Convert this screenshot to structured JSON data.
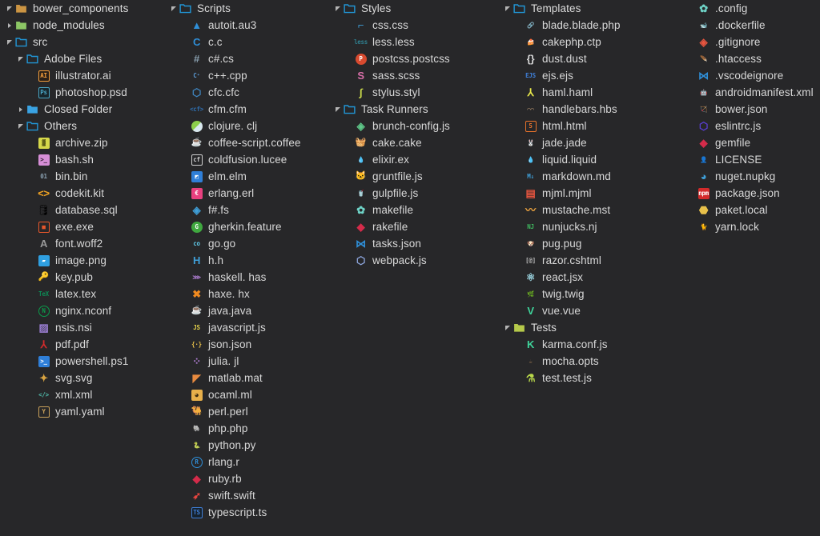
{
  "app": {
    "title": "File Icons Tree",
    "background": "#272729",
    "text_color": "#d8d8d8"
  },
  "columns": [
    {
      "name": "column-1",
      "rows": [
        {
          "indent": 0,
          "arrow": "open",
          "icon": "folder-bower",
          "label": "bower_components",
          "type": "folder"
        },
        {
          "indent": 0,
          "arrow": "closed",
          "icon": "folder-node",
          "label": "node_modules",
          "type": "folder"
        },
        {
          "indent": 0,
          "arrow": "open",
          "icon": "folder-blue",
          "label": "src",
          "type": "folder"
        },
        {
          "indent": 1,
          "arrow": "open",
          "icon": "folder-blue",
          "label": "Adobe Files",
          "type": "folder"
        },
        {
          "indent": 2,
          "arrow": "none",
          "icon": "illustrator-icon",
          "label": "illustrator.ai",
          "type": "file"
        },
        {
          "indent": 2,
          "arrow": "none",
          "icon": "photoshop-icon",
          "label": "photoshop.psd",
          "type": "file"
        },
        {
          "indent": 1,
          "arrow": "closed",
          "icon": "folder-blue-closed",
          "label": "Closed Folder",
          "type": "folder"
        },
        {
          "indent": 1,
          "arrow": "open",
          "icon": "folder-blue",
          "label": "Others",
          "type": "folder"
        },
        {
          "indent": 2,
          "arrow": "none",
          "icon": "zip-icon",
          "label": "archive.zip",
          "type": "file"
        },
        {
          "indent": 2,
          "arrow": "none",
          "icon": "shell-icon",
          "label": "bash.sh",
          "type": "file"
        },
        {
          "indent": 2,
          "arrow": "none",
          "icon": "binary-icon",
          "label": "bin.bin",
          "type": "file"
        },
        {
          "indent": 2,
          "arrow": "none",
          "icon": "codekit-icon",
          "label": "codekit.kit",
          "type": "file"
        },
        {
          "indent": 2,
          "arrow": "none",
          "icon": "database-icon",
          "label": "database.sql",
          "type": "file"
        },
        {
          "indent": 2,
          "arrow": "none",
          "icon": "exe-icon",
          "label": "exe.exe",
          "type": "file"
        },
        {
          "indent": 2,
          "arrow": "none",
          "icon": "font-icon",
          "label": "font.woff2",
          "type": "file"
        },
        {
          "indent": 2,
          "arrow": "none",
          "icon": "image-icon",
          "label": "image.png",
          "type": "file"
        },
        {
          "indent": 2,
          "arrow": "none",
          "icon": "key-icon",
          "label": "key.pub",
          "type": "file"
        },
        {
          "indent": 2,
          "arrow": "none",
          "icon": "tex-icon",
          "label": "latex.tex",
          "type": "file"
        },
        {
          "indent": 2,
          "arrow": "none",
          "icon": "nginx-icon",
          "label": "nginx.nconf",
          "type": "file"
        },
        {
          "indent": 2,
          "arrow": "none",
          "icon": "nsis-icon",
          "label": "nsis.nsi",
          "type": "file"
        },
        {
          "indent": 2,
          "arrow": "none",
          "icon": "pdf-icon",
          "label": "pdf.pdf",
          "type": "file"
        },
        {
          "indent": 2,
          "arrow": "none",
          "icon": "powershell-icon",
          "label": "powershell.ps1",
          "type": "file"
        },
        {
          "indent": 2,
          "arrow": "none",
          "icon": "svg-icon",
          "label": "svg.svg",
          "type": "file"
        },
        {
          "indent": 2,
          "arrow": "none",
          "icon": "xml-icon",
          "label": "xml.xml",
          "type": "file"
        },
        {
          "indent": 2,
          "arrow": "none",
          "icon": "yaml-icon",
          "label": "yaml.yaml",
          "type": "file"
        }
      ]
    },
    {
      "name": "column-2",
      "rows": [
        {
          "indent": 0,
          "arrow": "open",
          "icon": "folder-blue",
          "label": "Scripts",
          "type": "folder"
        },
        {
          "indent": 1,
          "arrow": "none",
          "icon": "autoit-icon",
          "label": "autoit.au3",
          "type": "file"
        },
        {
          "indent": 1,
          "arrow": "none",
          "icon": "c-icon",
          "label": "c.c",
          "type": "file"
        },
        {
          "indent": 1,
          "arrow": "none",
          "icon": "csharp-icon",
          "label": "c#.cs",
          "type": "file"
        },
        {
          "indent": 1,
          "arrow": "none",
          "icon": "cpp-icon",
          "label": "c++.cpp",
          "type": "file"
        },
        {
          "indent": 1,
          "arrow": "none",
          "icon": "cfc-icon",
          "label": "cfc.cfc",
          "type": "file"
        },
        {
          "indent": 1,
          "arrow": "none",
          "icon": "cfm-icon",
          "label": "cfm.cfm",
          "type": "file"
        },
        {
          "indent": 1,
          "arrow": "none",
          "icon": "clojure-icon",
          "label": "clojure. clj",
          "type": "file"
        },
        {
          "indent": 1,
          "arrow": "none",
          "icon": "coffeescript-icon",
          "label": "coffee-script.coffee",
          "type": "file"
        },
        {
          "indent": 1,
          "arrow": "none",
          "icon": "coldfusion-icon",
          "label": "coldfusion.lucee",
          "type": "file"
        },
        {
          "indent": 1,
          "arrow": "none",
          "icon": "elm-icon",
          "label": "elm.elm",
          "type": "file"
        },
        {
          "indent": 1,
          "arrow": "none",
          "icon": "erlang-icon",
          "label": "erlang.erl",
          "type": "file"
        },
        {
          "indent": 1,
          "arrow": "none",
          "icon": "fsharp-icon",
          "label": "f#.fs",
          "type": "file"
        },
        {
          "indent": 1,
          "arrow": "none",
          "icon": "gherkin-icon",
          "label": "gherkin.feature",
          "type": "file"
        },
        {
          "indent": 1,
          "arrow": "none",
          "icon": "go-icon",
          "label": "go.go",
          "type": "file"
        },
        {
          "indent": 1,
          "arrow": "none",
          "icon": "header-icon",
          "label": "h.h",
          "type": "file"
        },
        {
          "indent": 1,
          "arrow": "none",
          "icon": "haskell-icon",
          "label": "haskell. has",
          "type": "file"
        },
        {
          "indent": 1,
          "arrow": "none",
          "icon": "haxe-icon",
          "label": "haxe. hx",
          "type": "file"
        },
        {
          "indent": 1,
          "arrow": "none",
          "icon": "java-icon",
          "label": "java.java",
          "type": "file"
        },
        {
          "indent": 1,
          "arrow": "none",
          "icon": "javascript-icon",
          "label": "javascript.js",
          "type": "file"
        },
        {
          "indent": 1,
          "arrow": "none",
          "icon": "json-icon",
          "label": "json.json",
          "type": "file"
        },
        {
          "indent": 1,
          "arrow": "none",
          "icon": "julia-icon",
          "label": "julia. jl",
          "type": "file"
        },
        {
          "indent": 1,
          "arrow": "none",
          "icon": "matlab-icon",
          "label": "matlab.mat",
          "type": "file"
        },
        {
          "indent": 1,
          "arrow": "none",
          "icon": "ocaml-icon",
          "label": "ocaml.ml",
          "type": "file"
        },
        {
          "indent": 1,
          "arrow": "none",
          "icon": "perl-icon",
          "label": "perl.perl",
          "type": "file"
        },
        {
          "indent": 1,
          "arrow": "none",
          "icon": "php-icon",
          "label": "php.php",
          "type": "file"
        },
        {
          "indent": 1,
          "arrow": "none",
          "icon": "python-icon",
          "label": "python.py",
          "type": "file"
        },
        {
          "indent": 1,
          "arrow": "none",
          "icon": "r-icon",
          "label": "rlang.r",
          "type": "file"
        },
        {
          "indent": 1,
          "arrow": "none",
          "icon": "ruby-icon",
          "label": "ruby.rb",
          "type": "file"
        },
        {
          "indent": 1,
          "arrow": "none",
          "icon": "swift-icon",
          "label": "swift.swift",
          "type": "file"
        },
        {
          "indent": 1,
          "arrow": "none",
          "icon": "typescript-icon",
          "label": "typescript.ts",
          "type": "file"
        }
      ]
    },
    {
      "name": "column-3",
      "rows": [
        {
          "indent": 0,
          "arrow": "open",
          "icon": "folder-blue",
          "label": "Styles",
          "type": "folder"
        },
        {
          "indent": 1,
          "arrow": "none",
          "icon": "css-icon",
          "label": "css.css",
          "type": "file"
        },
        {
          "indent": 1,
          "arrow": "none",
          "icon": "less-icon",
          "label": "less.less",
          "type": "file"
        },
        {
          "indent": 1,
          "arrow": "none",
          "icon": "postcss-icon",
          "label": "postcss.postcss",
          "type": "file"
        },
        {
          "indent": 1,
          "arrow": "none",
          "icon": "sass-icon",
          "label": "sass.scss",
          "type": "file"
        },
        {
          "indent": 1,
          "arrow": "none",
          "icon": "stylus-icon",
          "label": "stylus.styl",
          "type": "file"
        },
        {
          "indent": 0,
          "arrow": "open",
          "icon": "folder-blue",
          "label": "Task Runners",
          "type": "folder"
        },
        {
          "indent": 1,
          "arrow": "none",
          "icon": "brunch-icon",
          "label": "brunch-config.js",
          "type": "file"
        },
        {
          "indent": 1,
          "arrow": "none",
          "icon": "cake-icon",
          "label": "cake.cake",
          "type": "file"
        },
        {
          "indent": 1,
          "arrow": "none",
          "icon": "elixir-icon",
          "label": "elixir.ex",
          "type": "file"
        },
        {
          "indent": 1,
          "arrow": "none",
          "icon": "grunt-icon",
          "label": "gruntfile.js",
          "type": "file"
        },
        {
          "indent": 1,
          "arrow": "none",
          "icon": "gulp-icon",
          "label": "gulpfile.js",
          "type": "file"
        },
        {
          "indent": 1,
          "arrow": "none",
          "icon": "make-icon",
          "label": "makefile",
          "type": "file"
        },
        {
          "indent": 1,
          "arrow": "none",
          "icon": "rake-icon",
          "label": "rakefile",
          "type": "file"
        },
        {
          "indent": 1,
          "arrow": "none",
          "icon": "vscode-icon",
          "label": "tasks.json",
          "type": "file"
        },
        {
          "indent": 1,
          "arrow": "none",
          "icon": "webpack-icon",
          "label": "webpack.js",
          "type": "file"
        }
      ]
    },
    {
      "name": "column-4",
      "rows": [
        {
          "indent": 0,
          "arrow": "open",
          "icon": "folder-blue",
          "label": "Templates",
          "type": "folder"
        },
        {
          "indent": 1,
          "arrow": "none",
          "icon": "blade-icon",
          "label": "blade.blade.php",
          "type": "file"
        },
        {
          "indent": 1,
          "arrow": "none",
          "icon": "cakephp-icon",
          "label": "cakephp.ctp",
          "type": "file"
        },
        {
          "indent": 1,
          "arrow": "none",
          "icon": "dust-icon",
          "label": "dust.dust",
          "type": "file"
        },
        {
          "indent": 1,
          "arrow": "none",
          "icon": "ejs-icon",
          "label": "ejs.ejs",
          "type": "file"
        },
        {
          "indent": 1,
          "arrow": "none",
          "icon": "haml-icon",
          "label": "haml.haml",
          "type": "file"
        },
        {
          "indent": 1,
          "arrow": "none",
          "icon": "handlebars-icon",
          "label": "handlebars.hbs",
          "type": "file"
        },
        {
          "indent": 1,
          "arrow": "none",
          "icon": "html-icon",
          "label": "html.html",
          "type": "file"
        },
        {
          "indent": 1,
          "arrow": "none",
          "icon": "jade-icon",
          "label": "jade.jade",
          "type": "file"
        },
        {
          "indent": 1,
          "arrow": "none",
          "icon": "liquid-icon",
          "label": "liquid.liquid",
          "type": "file"
        },
        {
          "indent": 1,
          "arrow": "none",
          "icon": "markdown-icon",
          "label": "markdown.md",
          "type": "file"
        },
        {
          "indent": 1,
          "arrow": "none",
          "icon": "mjml-icon",
          "label": "mjml.mjml",
          "type": "file"
        },
        {
          "indent": 1,
          "arrow": "none",
          "icon": "mustache-icon",
          "label": "mustache.mst",
          "type": "file"
        },
        {
          "indent": 1,
          "arrow": "none",
          "icon": "nunjucks-icon",
          "label": "nunjucks.nj",
          "type": "file"
        },
        {
          "indent": 1,
          "arrow": "none",
          "icon": "pug-icon",
          "label": "pug.pug",
          "type": "file"
        },
        {
          "indent": 1,
          "arrow": "none",
          "icon": "razor-icon",
          "label": "razor.cshtml",
          "type": "file"
        },
        {
          "indent": 1,
          "arrow": "none",
          "icon": "react-icon",
          "label": "react.jsx",
          "type": "file"
        },
        {
          "indent": 1,
          "arrow": "none",
          "icon": "twig-icon",
          "label": "twig.twig",
          "type": "file"
        },
        {
          "indent": 1,
          "arrow": "none",
          "icon": "vue-icon",
          "label": "vue.vue",
          "type": "file"
        },
        {
          "indent": 0,
          "arrow": "open",
          "icon": "folder-green",
          "label": "Tests",
          "type": "folder"
        },
        {
          "indent": 1,
          "arrow": "none",
          "icon": "karma-icon",
          "label": "karma.conf.js",
          "type": "file"
        },
        {
          "indent": 1,
          "arrow": "none",
          "icon": "mocha-icon",
          "label": "mocha.opts",
          "type": "file"
        },
        {
          "indent": 1,
          "arrow": "none",
          "icon": "testjs-icon",
          "label": "test.test.js",
          "type": "file"
        }
      ]
    },
    {
      "name": "column-5",
      "rows": [
        {
          "indent": 0,
          "arrow": "none",
          "icon": "config-icon",
          "label": ".config",
          "type": "file"
        },
        {
          "indent": 0,
          "arrow": "none",
          "icon": "docker-icon",
          "label": ".dockerfile",
          "type": "file"
        },
        {
          "indent": 0,
          "arrow": "none",
          "icon": "git-icon",
          "label": ".gitignore",
          "type": "file"
        },
        {
          "indent": 0,
          "arrow": "none",
          "icon": "htaccess-icon",
          "label": ".htaccess",
          "type": "file"
        },
        {
          "indent": 0,
          "arrow": "none",
          "icon": "vscode-icon",
          "label": ".vscodeignore",
          "type": "file"
        },
        {
          "indent": 0,
          "arrow": "none",
          "icon": "android-icon",
          "label": "androidmanifest.xml",
          "type": "file"
        },
        {
          "indent": 0,
          "arrow": "none",
          "icon": "bower-icon",
          "label": "bower.json",
          "type": "file"
        },
        {
          "indent": 0,
          "arrow": "none",
          "icon": "eslint-icon",
          "label": "eslintrc.js",
          "type": "file"
        },
        {
          "indent": 0,
          "arrow": "none",
          "icon": "gem-icon",
          "label": "gemfile",
          "type": "file"
        },
        {
          "indent": 0,
          "arrow": "none",
          "icon": "license-icon",
          "label": "LICENSE",
          "type": "file"
        },
        {
          "indent": 0,
          "arrow": "none",
          "icon": "nuget-icon",
          "label": "nuget.nupkg",
          "type": "file"
        },
        {
          "indent": 0,
          "arrow": "none",
          "icon": "npm-icon",
          "label": "package.json",
          "type": "file"
        },
        {
          "indent": 0,
          "arrow": "none",
          "icon": "paket-icon",
          "label": "paket.local",
          "type": "file"
        },
        {
          "indent": 0,
          "arrow": "none",
          "icon": "yarn-icon",
          "label": "yarn.lock",
          "type": "file"
        }
      ]
    }
  ]
}
